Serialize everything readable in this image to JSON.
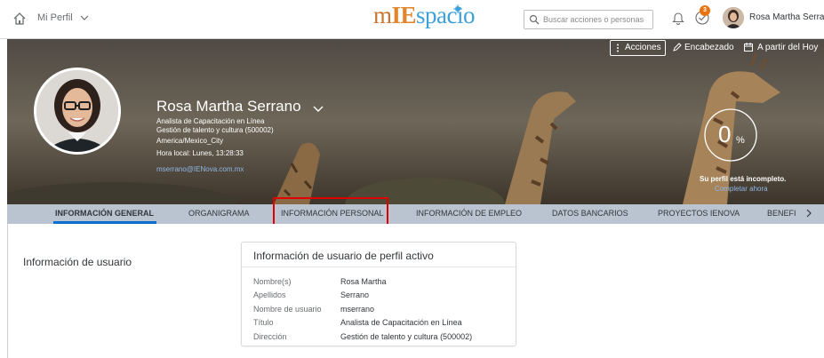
{
  "shell": {
    "nav_label": "Mi Perfil",
    "logo_m": "m",
    "logo_ie": "IE",
    "logo_spacio": "spacio",
    "search_placeholder": "Buscar acciones o personas",
    "notifications_badge": "3",
    "user_name": "Rosa Martha Serrano"
  },
  "header": {
    "actions": [
      {
        "label": "Acciones",
        "icon": "more-vertical-icon"
      },
      {
        "label": "Encabezado",
        "icon": "pencil-icon"
      },
      {
        "label": "A partir del Hoy",
        "icon": "calendar-icon"
      }
    ],
    "name": "Rosa Martha Serrano",
    "job_title": "Analista de Capacitación en Línea",
    "department": "Gestión de talento y cultura (500002)",
    "timezone": "America/Mexico_City",
    "local_time": "Hora local: Lunes, 13:28:33",
    "email": "mserrano@IENova.com.mx",
    "profile_percent": "0",
    "percent_sign": "%",
    "profile_completion": 0,
    "incomplete_text": "Su perfil está incompleto.",
    "complete_link": "Completar ahora"
  },
  "tabs": [
    {
      "label": "INFORMACIÓN GENERAL",
      "active": true
    },
    {
      "label": "ORGANIGRAMA",
      "active": false
    },
    {
      "label": "INFORMACIÓN PERSONAL",
      "active": false
    },
    {
      "label": "INFORMACIÓN DE EMPLEO",
      "active": false
    },
    {
      "label": "DATOS BANCARIOS",
      "active": false
    },
    {
      "label": "PROYECTOS IENOVA",
      "active": false
    },
    {
      "label": "BENEFI",
      "active": false
    }
  ],
  "section_title": "Información de usuario",
  "card": {
    "title": "Información de usuario de perfil activo",
    "fields": [
      {
        "label": "Nombre(s)",
        "value": "Rosa Martha"
      },
      {
        "label": "Apellidos",
        "value": "Serrano"
      },
      {
        "label": "Nombre de usuario",
        "value": "mserrano"
      },
      {
        "label": "Título",
        "value": "Analista de Capacitación en Línea"
      },
      {
        "label": "Dirección",
        "value": "Gestión de talento y cultura (500002)"
      }
    ]
  },
  "colors": {
    "accent": "#0a6ed1",
    "highlight": "#e00000",
    "badge": "#e9730c",
    "tabbar": "#b9c4d0"
  }
}
